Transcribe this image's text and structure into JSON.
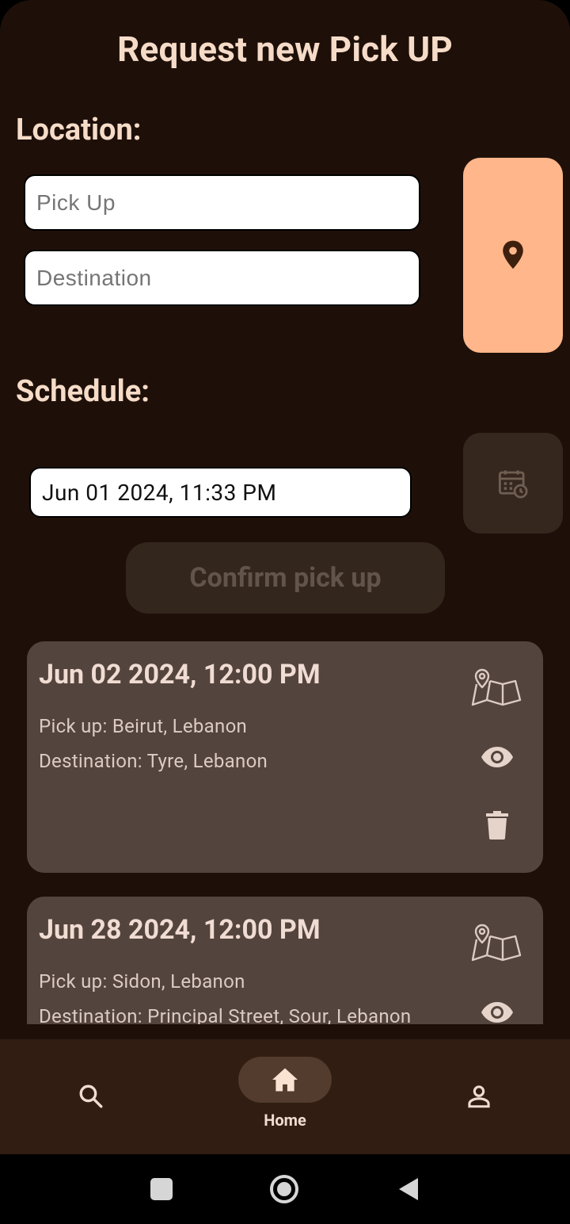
{
  "header": {
    "title": "Request new Pick UP"
  },
  "location": {
    "label": "Location:",
    "pickup_placeholder": "Pick Up",
    "destination_placeholder": "Destination",
    "map_button_icon": "location-pin-icon"
  },
  "schedule": {
    "label": "Schedule:",
    "datetime_value": "Jun 01 2024, 11:33 PM",
    "calendar_button_icon": "calendar-clock-icon"
  },
  "confirm": {
    "label": "Confirm pick up"
  },
  "pickups": [
    {
      "date": "Jun 02 2024, 12:00 PM",
      "pickup": "Pick up: Beirut, Lebanon",
      "destination": "Destination: Tyre, Lebanon"
    },
    {
      "date": "Jun 28 2024, 12:00 PM",
      "pickup": "Pick up: Sidon, Lebanon",
      "destination": "Destination: Principal Street, Sour, Lebanon"
    }
  ],
  "nav": {
    "items": [
      {
        "icon": "search-icon",
        "label": ""
      },
      {
        "icon": "home-icon",
        "label": "Home",
        "active": true
      },
      {
        "icon": "profile-icon",
        "label": ""
      }
    ]
  },
  "colors": {
    "background": "#1e1009",
    "accent": "#ffb68a",
    "card": "#53443d",
    "navbar": "#311d12",
    "text": "#f6dcc8"
  }
}
